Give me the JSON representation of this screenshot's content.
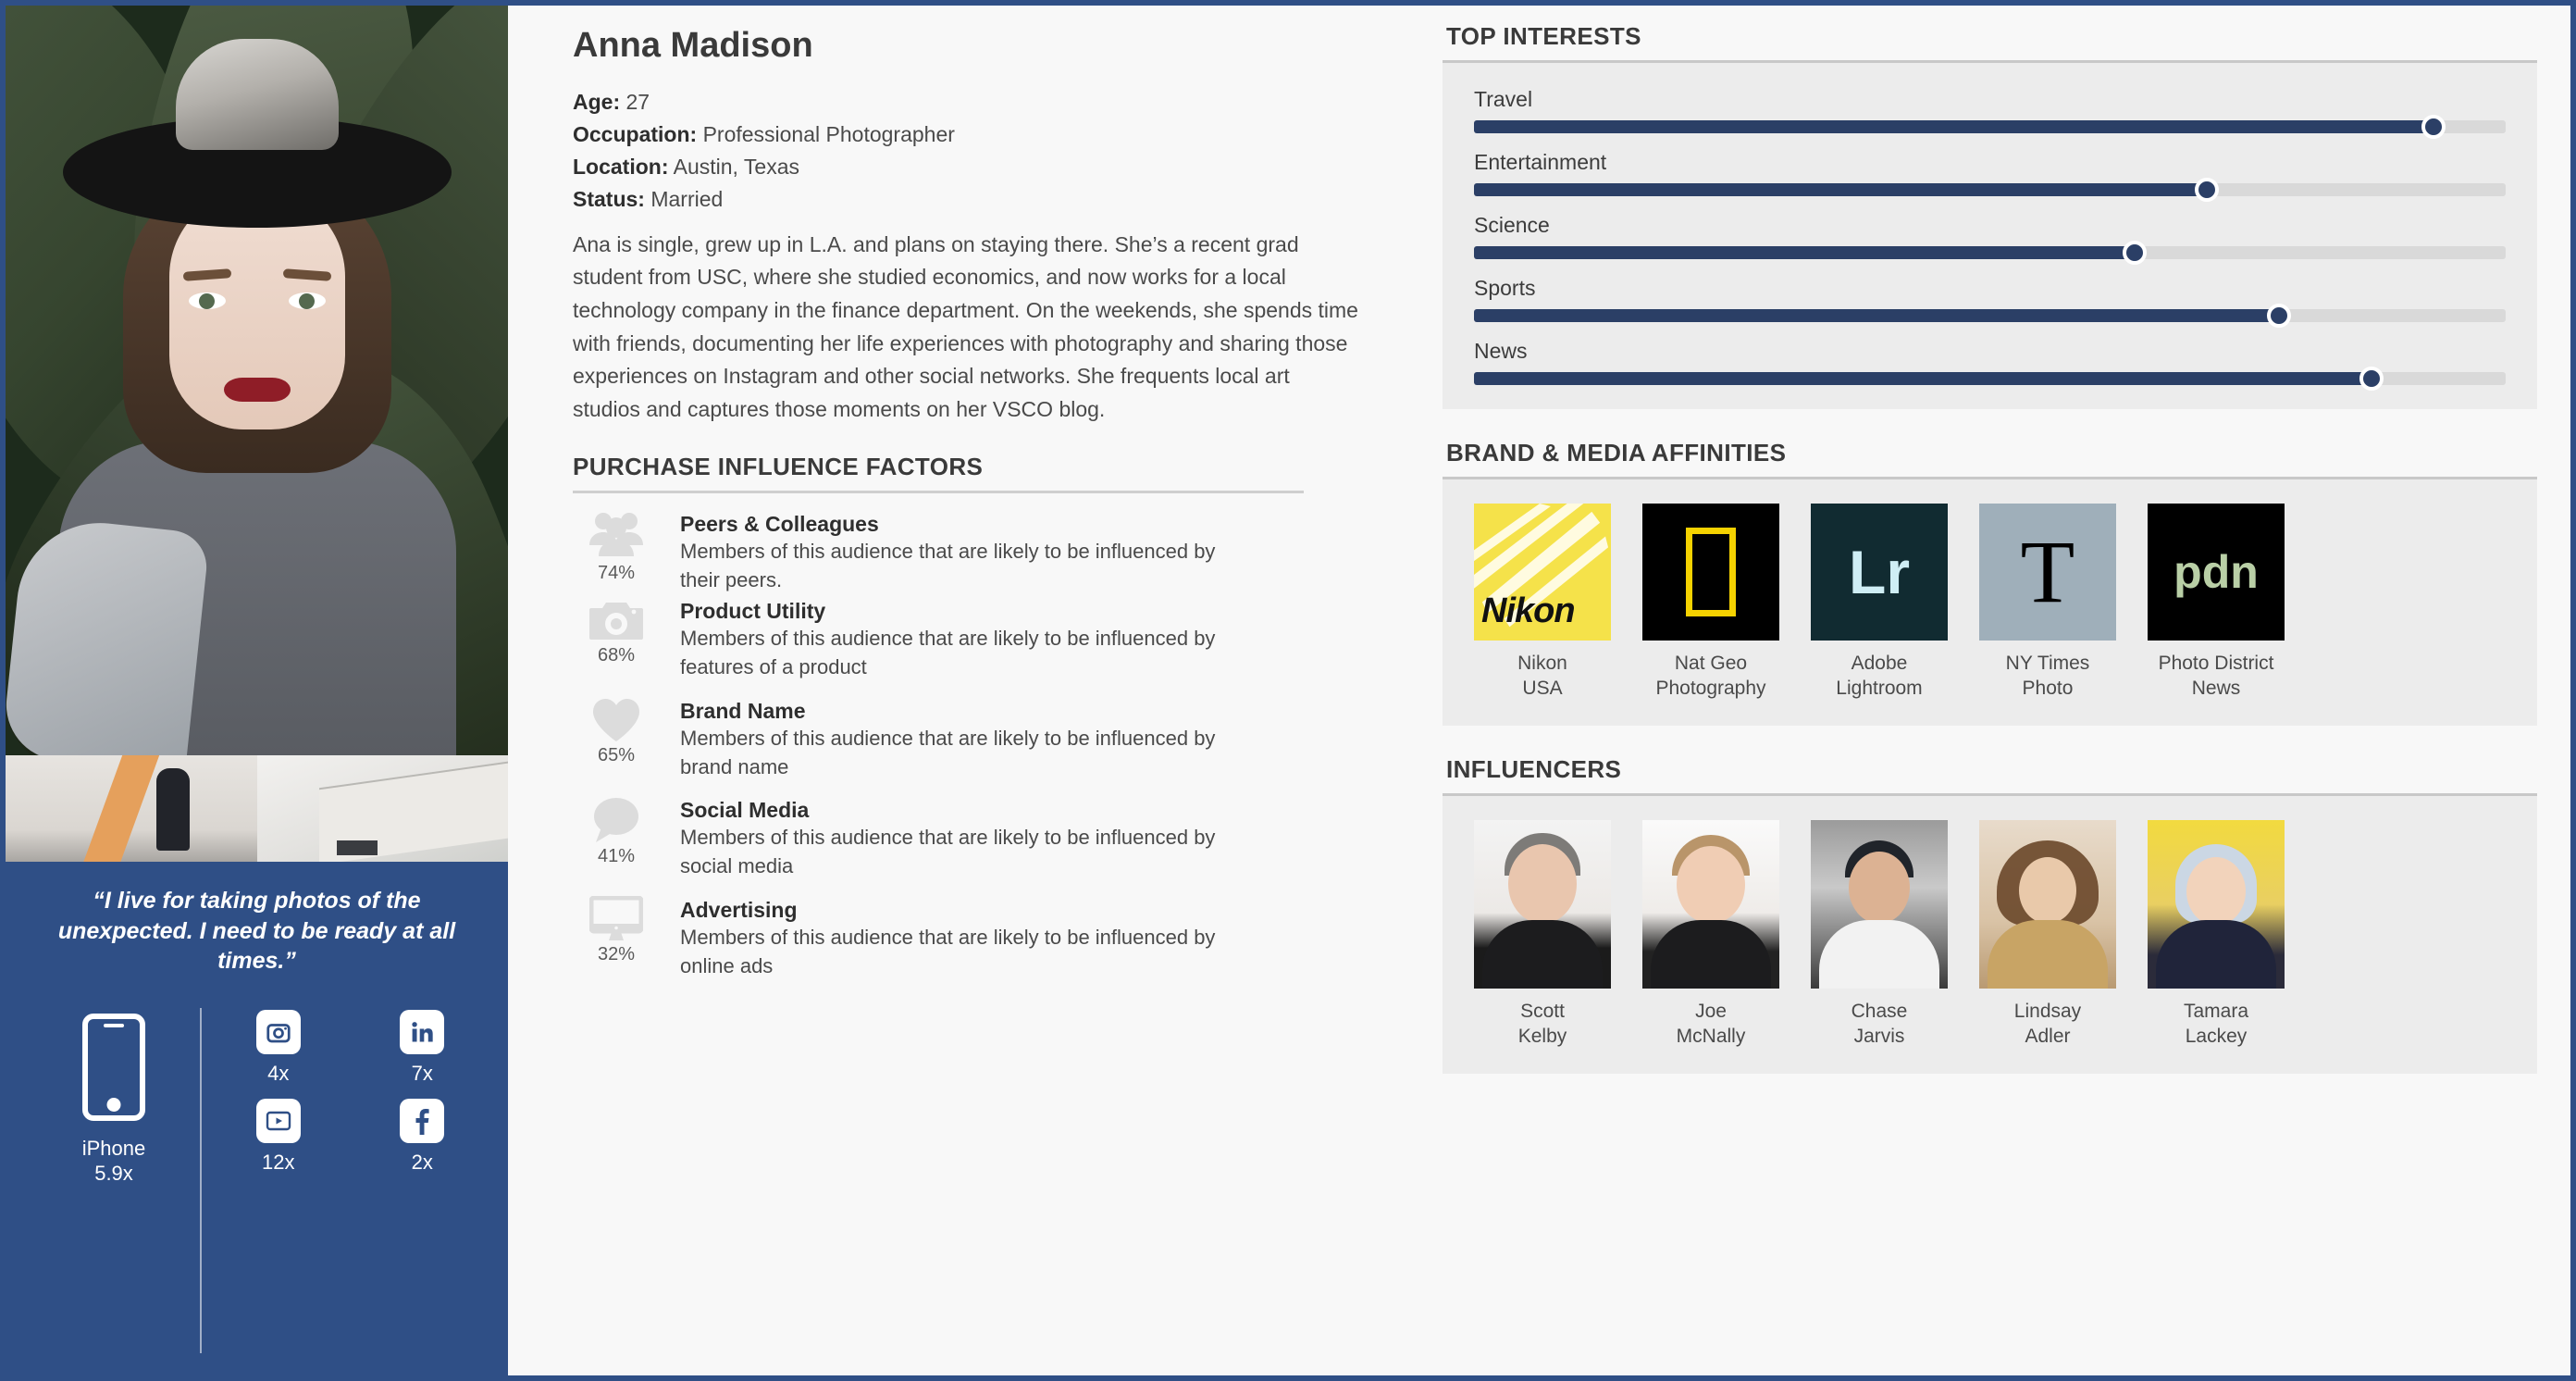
{
  "profile": {
    "name": "Anna Madison",
    "fields": [
      {
        "label": "Age:",
        "value": "27"
      },
      {
        "label": "Occupation:",
        "value": "Professional Photographer"
      },
      {
        "label": "Location:",
        "value": "Austin, Texas"
      },
      {
        "label": "Status:",
        "value": "Married"
      }
    ],
    "bio": "Ana is single, grew up in L.A. and plans on staying there. She’s a recent grad student from USC, where she studied economics, and now works for a local technology company in the finance department. On the weekends, she spends time with friends, documenting her life experiences with photography and sharing those experiences on Instagram and other social networks. She frequents local art studios and captures those moments on her VSCO blog."
  },
  "quote": {
    "text": "“I live for taking photos of the unexpected. I need to be ready at all times.”"
  },
  "device": {
    "name": "iPhone",
    "index": "5.9x",
    "icon": "phone-icon"
  },
  "social": [
    {
      "icon": "instagram-icon",
      "name": "Instagram",
      "count": "4x"
    },
    {
      "icon": "linkedin-icon",
      "name": "LinkedIn",
      "count": "7x"
    },
    {
      "icon": "youtube-icon",
      "name": "YouTube",
      "count": "12x"
    },
    {
      "icon": "facebook-icon",
      "name": "Facebook",
      "count": "2x"
    }
  ],
  "purchase": {
    "title": "PURCHASE INFLUENCE FACTORS",
    "factors": [
      {
        "icon": "people-icon",
        "pct": "74%",
        "name": "Peers & Colleagues",
        "desc": "Members of this audience that are likely to be influenced by their peers."
      },
      {
        "icon": "camera-icon",
        "pct": "68%",
        "name": "Product Utility",
        "desc": "Members of this audience that are likely to be influenced by features of a product"
      },
      {
        "icon": "heart-icon",
        "pct": "65%",
        "name": "Brand Name",
        "desc": "Members of this audience that are likely to be influenced by brand name"
      },
      {
        "icon": "speech-bubble-icon",
        "pct": "41%",
        "name": "Social Media",
        "desc": "Members of this audience that are likely to be influenced by social media"
      },
      {
        "icon": "monitor-icon",
        "pct": "32%",
        "name": "Advertising",
        "desc": "Members of this audience that are likely to be influenced by online ads"
      }
    ]
  },
  "interests": {
    "title": "TOP INTERESTS",
    "items": [
      {
        "label": "Travel",
        "value": 93
      },
      {
        "label": "Entertainment",
        "value": 71
      },
      {
        "label": "Science",
        "value": 64
      },
      {
        "label": "Sports",
        "value": 78
      },
      {
        "label": "News",
        "value": 87
      }
    ]
  },
  "brands": {
    "title": "BRAND & MEDIA AFFINITIES",
    "items": [
      {
        "logo": "nikon-logo",
        "wordmark": "Nikon",
        "caption": "Nikon\nUSA"
      },
      {
        "logo": "national-geographic-logo",
        "wordmark": "",
        "caption": "Nat Geo\nPhotography"
      },
      {
        "logo": "adobe-lightroom-logo",
        "wordmark": "Lr",
        "caption": "Adobe\nLightroom"
      },
      {
        "logo": "new-york-times-logo",
        "wordmark": "T",
        "caption": "NY Times\nPhoto"
      },
      {
        "logo": "pdn-logo",
        "wordmark": "pdn",
        "caption": "Photo District\nNews"
      }
    ]
  },
  "influencers": {
    "title": "INFLUENCERS",
    "items": [
      {
        "name": "Scott\nKelby"
      },
      {
        "name": "Joe\nMcNally"
      },
      {
        "name": "Chase\nJarvis"
      },
      {
        "name": "Lindsay\nAdler"
      },
      {
        "name": "Tamara\nLackey"
      }
    ]
  },
  "colors": {
    "brand_blue": "#2f4f86",
    "slider_navy": "#2b3f66",
    "panel_grey": "#ececec",
    "page_bg": "#f8f8f8"
  }
}
